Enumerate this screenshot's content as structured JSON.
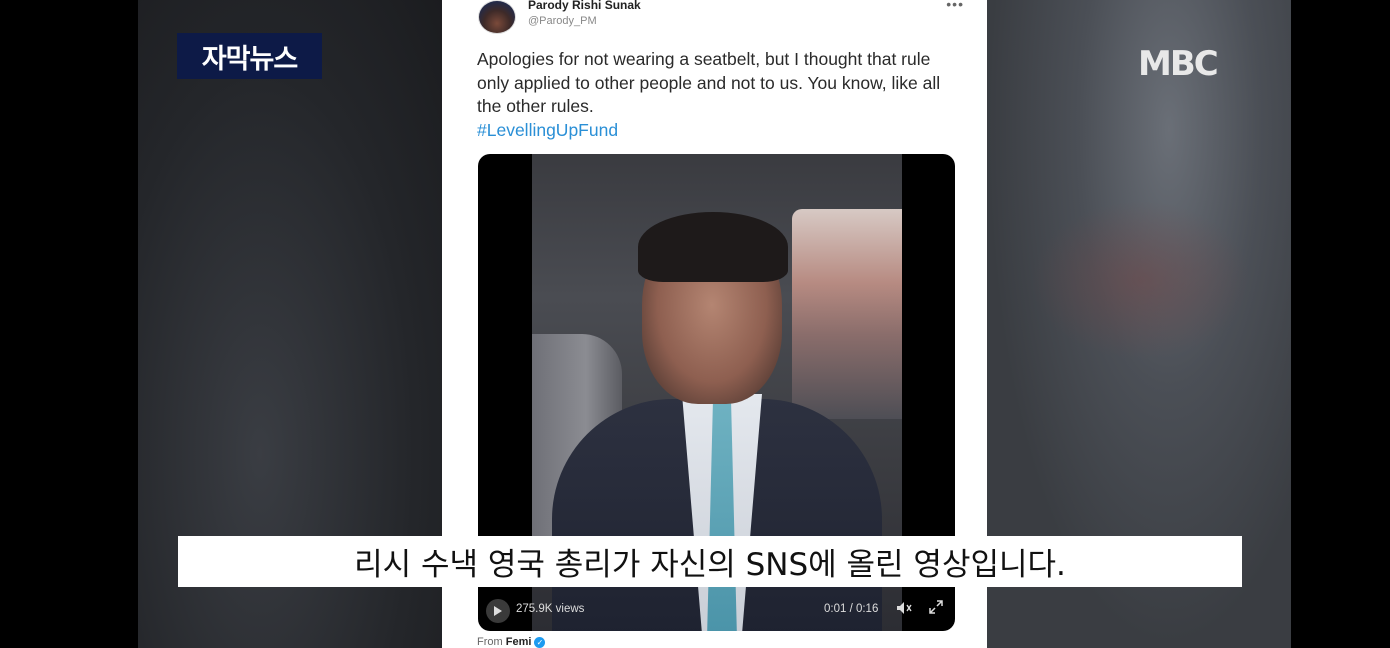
{
  "broadcast": {
    "news_logo": "자막뉴스",
    "channel_logo": "MBC",
    "subtitle": "리시 수낵 영국 총리가 자신의 SNS에 올린 영상입니다."
  },
  "tweet": {
    "author_name": "Parody Rishi Sunak",
    "author_handle": "@Parody_PM",
    "more_icon": "•••",
    "text": "Apologies for not wearing a seatbelt, but I thought that rule only applied to other people and not to us. You know, like all the other rules.",
    "hashtag": "#LevellingUpFund",
    "video": {
      "views": "275.9K views",
      "time": "0:01 / 0:16",
      "play_icon": "play-icon",
      "mute_icon": "mute-icon",
      "expand_icon": "expand-icon"
    },
    "from_label": "From",
    "from_user": "Femi",
    "verified_mark": "✓"
  }
}
